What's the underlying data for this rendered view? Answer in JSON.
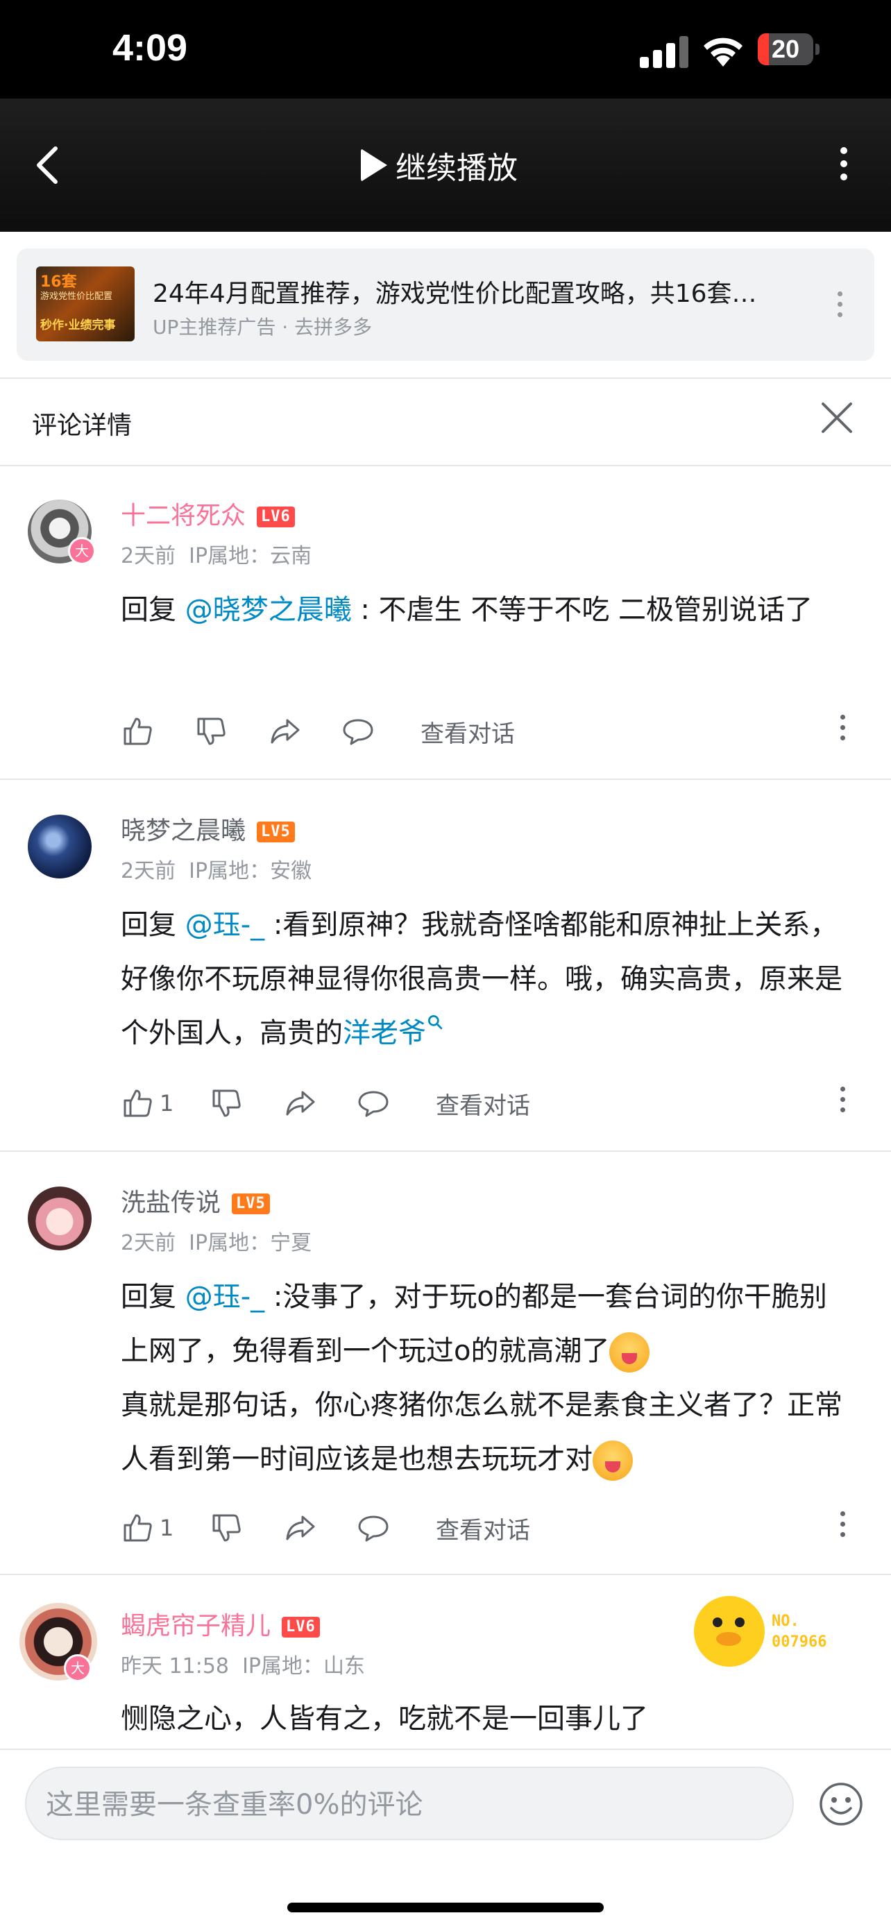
{
  "status_bar": {
    "time": "4:09",
    "battery_level": "20",
    "battery_fraction": 0.2
  },
  "navbar": {
    "continue_label": "继续播放"
  },
  "ad": {
    "thumb_text_1": "16套",
    "thumb_text_2": "游戏党性价比配置",
    "thumb_text_3": "秒作·业绩完事",
    "title": "24年4月配置推荐，游戏党性价比配置攻略，共16套…",
    "subtitle": "UP主推荐广告 · 去拼多多"
  },
  "detail_header": {
    "title": "评论详情"
  },
  "comments": [
    {
      "username": "十二将死众",
      "level": "LV6",
      "badge": "大",
      "time": "2天前",
      "ip": "IP属地：云南",
      "reply_prefix": "回复",
      "mention": "@晓梦之晨曦",
      "text": " : 不虐生 不等于不吃 二极管别说话了",
      "likes": "",
      "view_dialog": "查看对话"
    },
    {
      "username": "晓梦之晨曦",
      "level": "LV5",
      "time": "2天前",
      "ip": "IP属地：安徽",
      "reply_prefix": "回复",
      "mention": "@珏-_",
      "text": " :看到原神？我就奇怪啥都能和原神扯上关系，好像你不玩原神显得你很高贵一样。哦，确实高贵，原来是个外国人，高贵的",
      "link_text": "洋老爷",
      "likes": "1",
      "view_dialog": "查看对话"
    },
    {
      "username": "洗盐传说",
      "level": "LV5",
      "time": "2天前",
      "ip": "IP属地：宁夏",
      "reply_prefix": "回复",
      "mention": "@珏-_",
      "text_1": " :没事了，对于玩o的都是一套台词的你干脆别上网了，免得看到一个玩过o的就高潮了",
      "text_2": "真就是那句话，你心疼猪你怎么就不是素食主义者了？正常人看到第一时间应该是也想去玩玩才对",
      "likes": "1",
      "view_dialog": "查看对话"
    },
    {
      "username": "蝎虎帘子精儿",
      "level": "LV6",
      "badge": "大",
      "time": "昨天 11:58",
      "ip": "IP属地：山东",
      "text": "恻隐之心，人皆有之，吃就不是一回事儿了",
      "fan_no_label": "NO.",
      "fan_no": "007966"
    }
  ],
  "bottom": {
    "input_placeholder": "这里需要一条查重率0%的评论"
  },
  "colors": {
    "pink": "#fb7299",
    "link_blue": "#008ac5",
    "lv6": "#ff4a4a",
    "lv5": "#ff7a1a"
  }
}
